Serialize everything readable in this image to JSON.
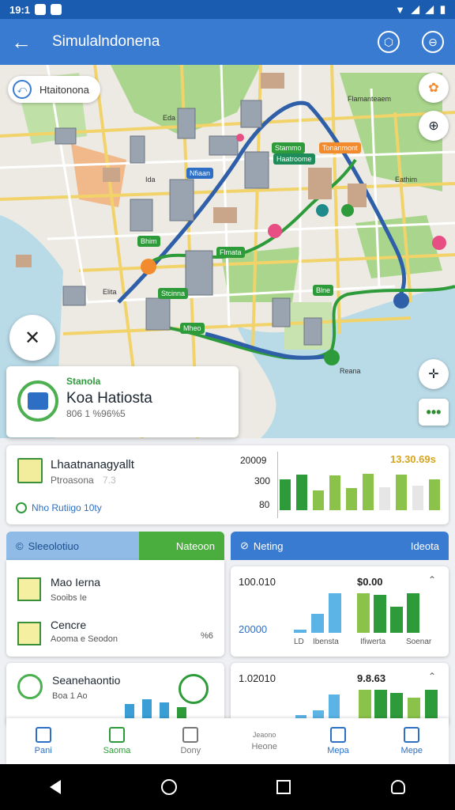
{
  "statusbar": {
    "time": "19:1"
  },
  "appbar": {
    "title": "Simulalndonena"
  },
  "map": {
    "search_label": "Htaitonona",
    "labels": [
      "Eda",
      "Ida",
      "Flamanteaem",
      "Eathim",
      "Reana",
      "Elita"
    ],
    "tags": [
      "Stammo",
      "Tonanmont",
      "Nfiaan",
      "Bhim",
      "Flmata",
      "Stcinna",
      "Blne",
      "Mheo",
      "Haatroome"
    ]
  },
  "info_card": {
    "category": "Stanola",
    "name": "Koa Hatiosta",
    "detail": "806 1 %96%5"
  },
  "summary_card": {
    "title": "Lhaatnanagyallt",
    "subtitle": "Ptroasona",
    "subtitle_extra": "7.3",
    "link": "Nho Rutiigo 10ty",
    "axis": [
      "20009",
      "300",
      "80"
    ],
    "percent": "13.30.69s",
    "bars": [
      0.7,
      0.8,
      0.45,
      0.78,
      0.5,
      0.82,
      0.52,
      0.8,
      0.55,
      0.7
    ],
    "bar_colors": [
      "#2e9b3a",
      "#2e9b3a",
      "#8bc34a",
      "#8bc34a",
      "#8bc34a",
      "#8bc34a",
      "#e6e6e6",
      "#8bc34a",
      "#e6e6e6",
      "#8bc34a"
    ]
  },
  "left_panel": {
    "tab_left": "Sleeolotiuo",
    "tab_right": "Nateoon",
    "row1_title": "Mao Ierna",
    "row1_sub": "Sooibs Ie",
    "row2_title": "Cencre",
    "row2_sub": "Aooma e Seodon",
    "row2_note": "%6"
  },
  "right_panel": {
    "tab_left": "Neting",
    "tab_right": "Ideota",
    "top_left": "100.010",
    "top_right": "$0.00",
    "axis": "20000",
    "labels": [
      "LD",
      "Ibensta",
      "Ifiwerta",
      "Soenar"
    ],
    "bars": [
      0.08,
      0.48,
      1.0,
      0.0,
      1.0,
      0.95,
      0.65,
      1.0
    ],
    "bar_colors": [
      "#5cb3e6",
      "#5cb3e6",
      "#5cb3e6",
      "#ffffff",
      "#8bc34a",
      "#2e9b3a",
      "#2e9b3a",
      "#2e9b3a"
    ]
  },
  "lower_left": {
    "title": "Seanehaontio",
    "sub": "Boa 1 Ao"
  },
  "lower_right": {
    "top_left": "1.02010",
    "top_right": "9.8.63"
  },
  "bottom_nav": {
    "items": [
      {
        "label": "Pani",
        "color": "#2c6fc4"
      },
      {
        "label": "Saoma",
        "color": "#2e9b3a"
      },
      {
        "label": "Dony",
        "color": "#777777"
      },
      {
        "label": "Heone",
        "color": "#777777"
      },
      {
        "label": "Mepa",
        "color": "#2c6fc4"
      },
      {
        "label": "Mepe",
        "color": "#2c6fc4"
      }
    ],
    "middle_extra": "Jeaono"
  }
}
